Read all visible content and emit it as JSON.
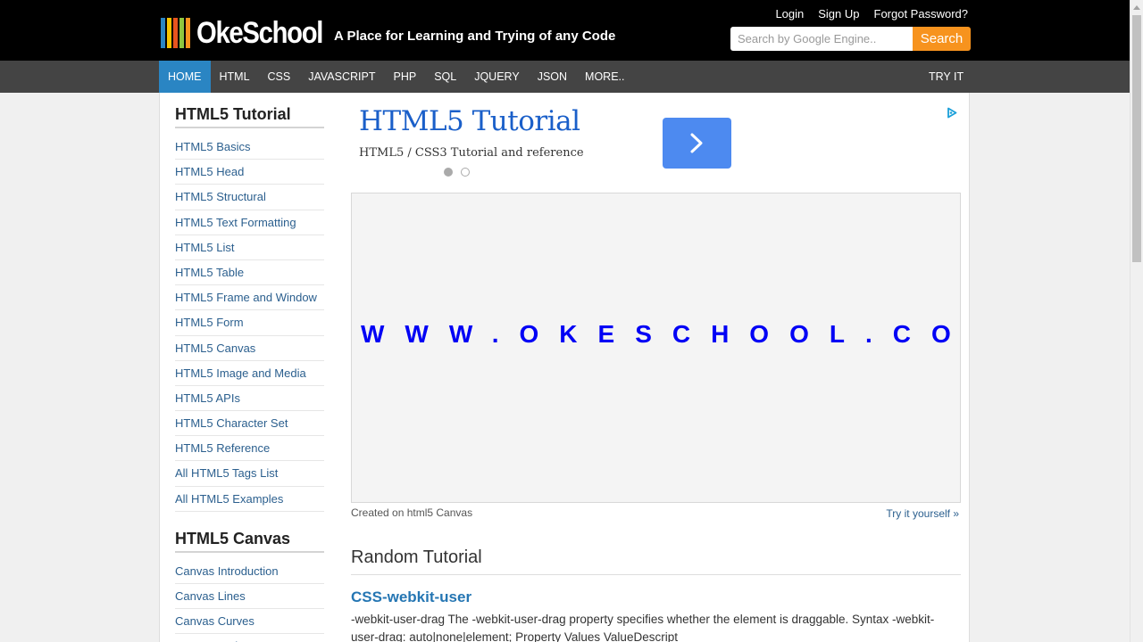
{
  "brand": {
    "name": "OkeSchool",
    "tagline": "A Place for Learning and Trying of any Code",
    "bar_colors": [
      "#2a85c3",
      "#f7c400",
      "#e8541e",
      "#8ec63f",
      "#f7931e"
    ]
  },
  "top_links": [
    "Login",
    "Sign Up",
    "Forgot Password?"
  ],
  "search": {
    "placeholder": "Search by Google Engine..",
    "button_label": "Search"
  },
  "nav": {
    "items": [
      "HOME",
      "HTML",
      "CSS",
      "JAVASCRIPT",
      "PHP",
      "SQL",
      "JQUERY",
      "JSON",
      "MORE.."
    ],
    "active": "HOME",
    "try_label": "TRY IT"
  },
  "sidebar": {
    "sections": [
      {
        "heading": "HTML5 Tutorial",
        "items": [
          "HTML5 Basics",
          "HTML5 Head",
          "HTML5 Structural",
          "HTML5 Text Formatting",
          "HTML5 List",
          "HTML5 Table",
          "HTML5 Frame and Window",
          "HTML5 Form",
          "HTML5 Canvas",
          "HTML5 Image and Media",
          "HTML5 APIs",
          "HTML5 Character Set",
          "HTML5 Reference",
          "All HTML5 Tags List",
          "All HTML5 Examples"
        ]
      },
      {
        "heading": "HTML5 Canvas",
        "items": [
          "Canvas Introduction",
          "Canvas Lines",
          "Canvas Curves",
          "Canvas Paths"
        ]
      }
    ]
  },
  "ad": {
    "title": "HTML5 Tutorial",
    "subtitle": "HTML5 / CSS3 Tutorial and reference",
    "accent": "#4d8af0"
  },
  "canvas": {
    "text": "WWW.OKESCHOOL.COM",
    "caption": "Created on html5 Canvas",
    "try_link": "Try it yourself »"
  },
  "random": {
    "heading": "Random Tutorial",
    "title": "CSS-webkit-user",
    "description": "-webkit-user-drag The -webkit-user-drag property specifies whether the element is draggable. Syntax -webkit-user-drag: auto|none|element; Property Values ValueDescript"
  }
}
